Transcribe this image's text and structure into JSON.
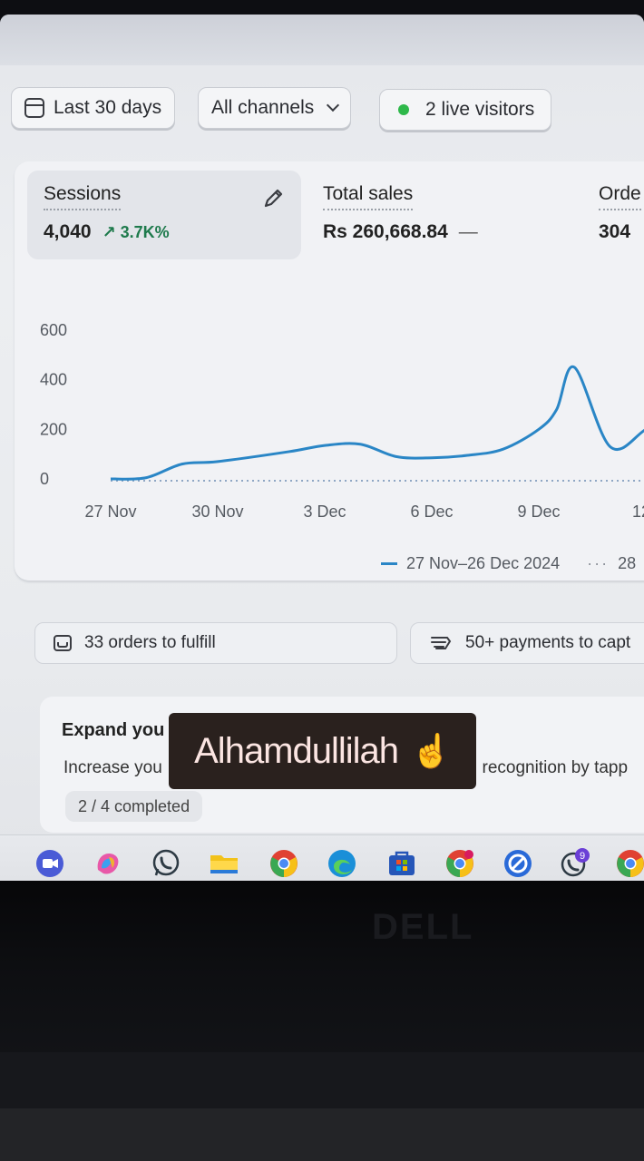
{
  "filters": {
    "date_range": "Last 30 days",
    "channels": "All channels",
    "live_visitors": "2 live visitors"
  },
  "metrics": [
    {
      "label": "Sessions",
      "value": "4,040",
      "change": "↗ 3.7K%"
    },
    {
      "label": "Total sales",
      "value": "Rs 260,668.84",
      "change": "—"
    },
    {
      "label": "Orde",
      "value": "304"
    }
  ],
  "chart_data": {
    "type": "line",
    "y_ticks": [
      "600",
      "400",
      "200",
      "0"
    ],
    "x_ticks": [
      "27 Nov",
      "30 Nov",
      "3 Dec",
      "6 Dec",
      "9 Dec",
      "12 I"
    ],
    "ylim": [
      0,
      600
    ],
    "series": [
      {
        "name": "27 Nov–26 Dec 2024",
        "color": "#2a86c6",
        "x": [
          "27 Nov",
          "28 Nov",
          "29 Nov",
          "30 Nov",
          "1 Dec",
          "2 Dec",
          "3 Dec",
          "4 Dec",
          "5 Dec",
          "6 Dec",
          "7 Dec",
          "8 Dec",
          "8.5 Dec",
          "9 Dec",
          "10 Dec",
          "11 Dec",
          "12 Dec",
          "12.5 Dec"
        ],
        "values": [
          0,
          5,
          60,
          70,
          110,
          135,
          140,
          90,
          85,
          95,
          120,
          200,
          280,
          450,
          130,
          200,
          300,
          180
        ]
      }
    ],
    "comparison_label": "28",
    "grid": false,
    "legend": "bottom-right"
  },
  "tasks": {
    "orders": "33 orders to fulfill",
    "payments": "50+ payments to capt"
  },
  "setup": {
    "title": "Expand you",
    "text": "Increase you",
    "text_right": "l recognition by tapp",
    "progress": "2 / 4 completed"
  },
  "sticker": {
    "text": "Alhamdullilah",
    "emoji": "☝️"
  },
  "taskbar": {
    "whatsapp_badge": "9"
  },
  "brand": "DELL"
}
